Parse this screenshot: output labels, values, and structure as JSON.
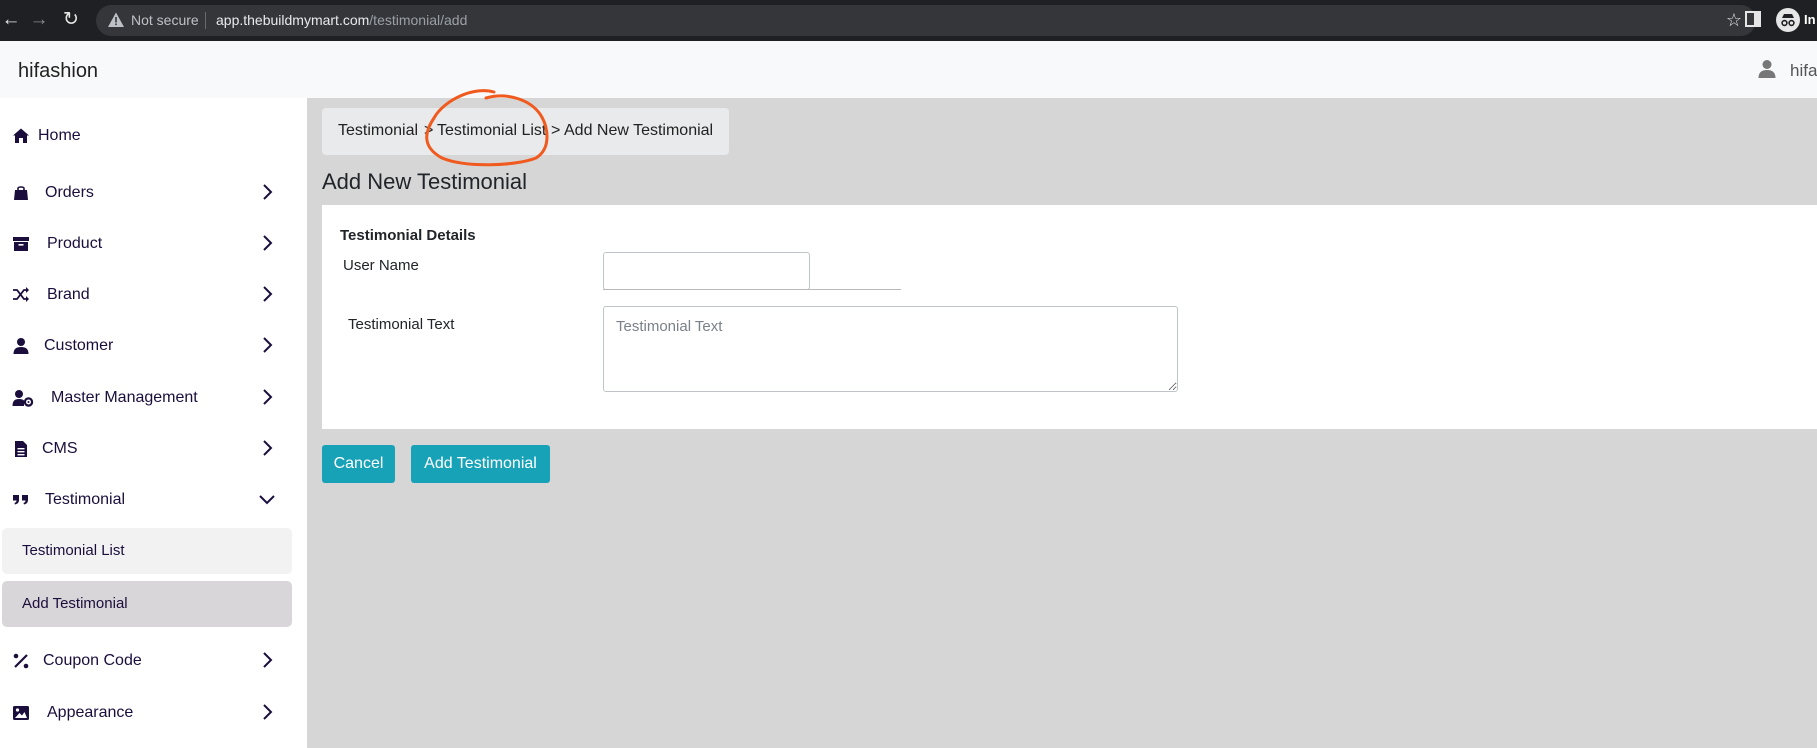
{
  "browser": {
    "not_secure": "Not secure",
    "url_host": "app.thebuildmymart.com",
    "url_path": "/testimonial/add",
    "profile_text": "In"
  },
  "header": {
    "brand": "hifashion",
    "user": "hifa"
  },
  "sidebar": {
    "items": [
      {
        "label": "Home",
        "icon": "home-icon"
      },
      {
        "label": "Orders",
        "icon": "shopping-bag-icon"
      },
      {
        "label": "Product",
        "icon": "archive-icon"
      },
      {
        "label": "Brand",
        "icon": "shuffle-icon"
      },
      {
        "label": "Customer",
        "icon": "user-icon"
      },
      {
        "label": "Master Management",
        "icon": "user-cog-icon"
      },
      {
        "label": "CMS",
        "icon": "file-icon"
      },
      {
        "label": "Testimonial",
        "icon": "quote-icon"
      },
      {
        "label": "Coupon Code",
        "icon": "percent-icon"
      },
      {
        "label": "Appearance",
        "icon": "image-icon"
      }
    ],
    "testimonial_sub": [
      {
        "label": "Testimonial List"
      },
      {
        "label": "Add Testimonial"
      }
    ]
  },
  "breadcrumb": {
    "root": "Testimonial",
    "sep1": ">",
    "list": "Testimonial List",
    "sep2": ">",
    "current": "Add New Testimonial"
  },
  "page": {
    "title": "Add New Testimonial"
  },
  "form": {
    "section_title": "Testimonial Details",
    "user_name_label": "User Name",
    "user_name_value": "",
    "text_label": "Testimonial Text",
    "text_placeholder": "Testimonial Text"
  },
  "actions": {
    "cancel": "Cancel",
    "add": "Add Testimonial"
  },
  "colors": {
    "accent": "#17a2b8",
    "sidebar_text": "#1b0e3c",
    "annotation": "#f05a1e",
    "active_sub_bg": "#d9d6d9"
  }
}
